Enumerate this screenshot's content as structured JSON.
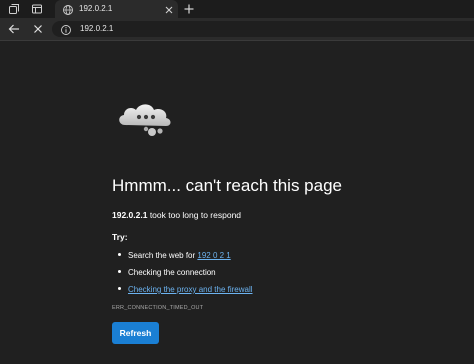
{
  "tab": {
    "title": "192.0.2.1",
    "globe_icon": "globe-icon",
    "close_icon": "close-icon"
  },
  "new_tab_icon": "plus-icon",
  "toolbar": {
    "back_icon": "back-arrow-icon",
    "stop_icon": "stop-icon",
    "address": "192.0.2.1",
    "info_icon": "info-icon"
  },
  "error": {
    "headline": "Hmmm... can't reach this page",
    "host": "192.0.2.1",
    "message": " took too long to respond",
    "try_label": "Try:",
    "suggestions": {
      "search_prefix": "Search the web for ",
      "search_link": "192 0 2 1",
      "check_connection": "Checking the connection",
      "check_proxy": "Checking the proxy and the firewall"
    },
    "code": "ERR_CONNECTION_TIMED_OUT",
    "refresh_label": "Refresh"
  },
  "colors": {
    "background": "#202020",
    "link": "#6cb3f0",
    "button": "#1a7fd4"
  }
}
